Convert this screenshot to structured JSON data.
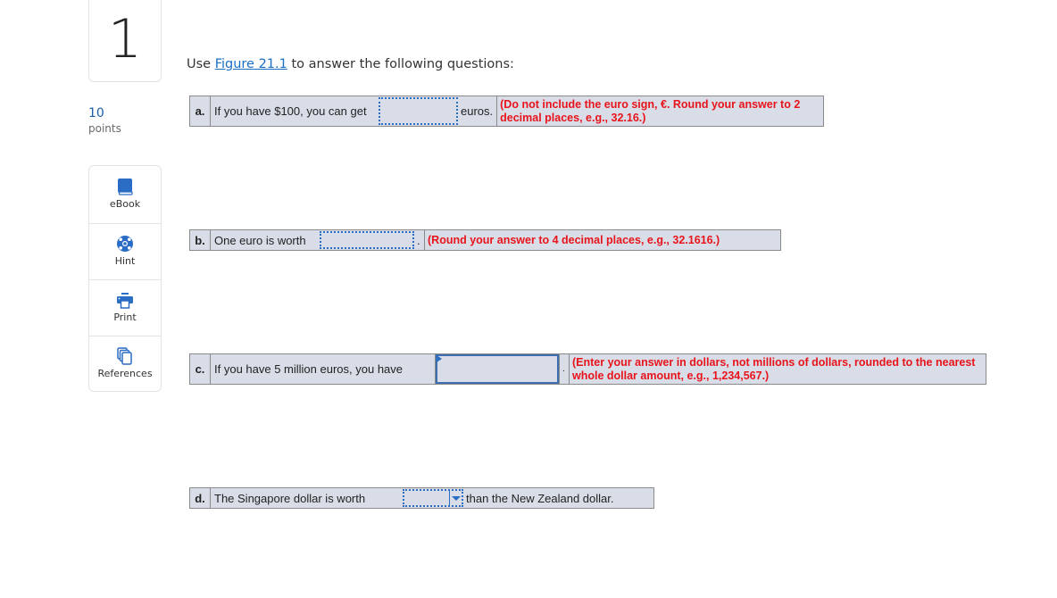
{
  "question": {
    "number": "1",
    "points_value": "10",
    "points_label": "points"
  },
  "tools": [
    {
      "label": "eBook",
      "icon": "book-icon"
    },
    {
      "label": "Hint",
      "icon": "lifebuoy-icon"
    },
    {
      "label": "Print",
      "icon": "printer-icon"
    },
    {
      "label": "References",
      "icon": "documents-icon"
    }
  ],
  "intro": {
    "prefix": "Use ",
    "link": "Figure 21.1",
    "suffix": " to answer the following questions:"
  },
  "parts": {
    "a": {
      "letter": "a.",
      "prompt": "If you have $100, you can get",
      "answer": "",
      "unit": "euros.",
      "instruction": "(Do not include the euro sign, €. Round your answer to 2 decimal places, e.g., 32.16.)"
    },
    "b": {
      "letter": "b.",
      "prompt": "One euro is worth",
      "answer": "",
      "punct": ".",
      "instruction": "(Round your answer to 4 decimal places, e.g., 32.1616.)"
    },
    "c": {
      "letter": "c.",
      "prompt": "If you have 5 million euros, you have",
      "answer": "",
      "punct": ".",
      "instruction": "(Enter your answer in dollars, not millions of dollars, rounded to the nearest whole dollar amount, e.g., 1,234,567.)"
    },
    "d": {
      "letter": "d.",
      "prompt": "The Singapore dollar is worth",
      "selected": "",
      "suffix": "than the New Zealand dollar."
    }
  },
  "colors": {
    "accent": "#2b6cc4",
    "instruction_red": "#e8141b",
    "row_bg": "#d9dde8",
    "points_blue": "#1a5fa8"
  }
}
